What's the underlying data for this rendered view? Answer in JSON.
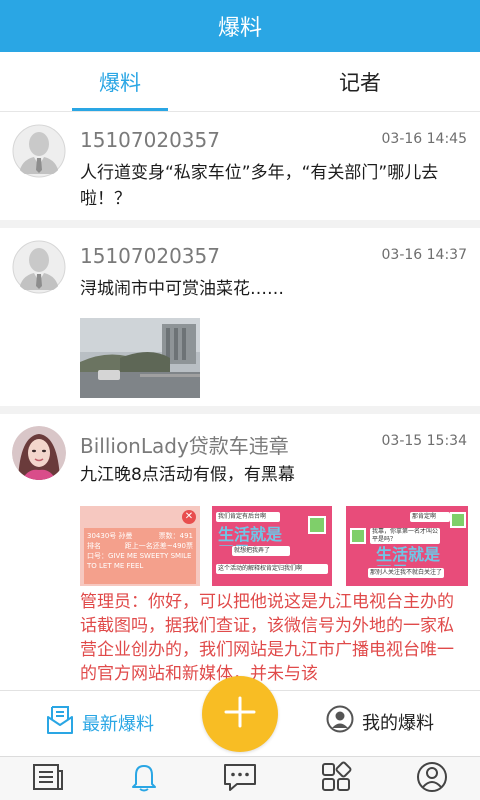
{
  "header": {
    "title": "爆料"
  },
  "tabs": [
    {
      "label": "爆料",
      "active": true
    },
    {
      "label": "记者",
      "active": false
    }
  ],
  "posts": [
    {
      "author": "15107020357",
      "time": "03-16 14:45",
      "content": "人行道变身“私家车位”多年，“有关部门”哪儿去啦！？",
      "avatar": "default-user-icon"
    },
    {
      "author": "15107020357",
      "time": "03-16 14:37",
      "content": "浔城闹市中可赏油菜花……",
      "avatar": "default-user-icon",
      "images": 1
    },
    {
      "author": "BillionLady贷款车违章",
      "time": "03-15 15:34",
      "content": "九江晚8点活动有假，有黑幕",
      "avatar": "user-photo",
      "images": 3,
      "image_texts": {
        "img1_header": "30430号 孙曼",
        "img1_votes": "票数：491",
        "img1_rank_label": "排名",
        "img1_rank": "距上一名还差~490票",
        "img1_slogan_label": "口号：",
        "img1_slogan": "GIVE ME SWEETY SMILE TO LET ME FEEL",
        "img2_msg1": "我们肯定有后台啊",
        "img2_big": "生活就是干果",
        "img2_msg2": "就想把我弄了",
        "img2_msg3": "这个活动的解释权肯定归我们啊",
        "img3_msg1": "那肯定啊",
        "img3_msg2": "我靠，你拿第一名才叫公平是吗？",
        "img3_big": "生活就是干果",
        "img3_msg3": "那别人关注我不就白关注了"
      },
      "reply": "管理员：你好，可以把他说这是九江电视台主办的话截图吗，据我们查证，该微信号为外地的一家私营企业创办的，我们网站是九江市广播电视台唯一的官方网站和新媒体，并未与该"
    }
  ],
  "bottom_bar": {
    "latest_label": "最新爆料",
    "mine_label": "我的爆料",
    "fab_icon": "plus-icon"
  },
  "nav": [
    {
      "icon": "news-icon"
    },
    {
      "icon": "bell-icon",
      "active": true
    },
    {
      "icon": "chat-icon"
    },
    {
      "icon": "apps-icon"
    },
    {
      "icon": "profile-icon"
    }
  ],
  "colors": {
    "primary": "#2aa6e4",
    "fab": "#f8bd24",
    "reply": "#e04a4a",
    "meta": "#7a7a7a"
  }
}
